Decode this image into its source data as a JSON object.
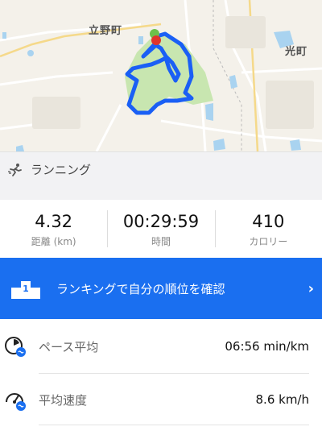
{
  "map": {
    "labels": [
      "立野町",
      "光町"
    ]
  },
  "activity": {
    "icon": "running-icon",
    "label": "ランニング"
  },
  "stats": [
    {
      "value": "4.32",
      "caption": "距離 (km)"
    },
    {
      "value": "00:29:59",
      "caption": "時間"
    },
    {
      "value": "410",
      "caption": "カロリー"
    }
  ],
  "ranking_banner": {
    "icon": "podium-icon",
    "text": "ランキングで自分の順位を確認",
    "chevron": "›",
    "color": "#1a6ff0"
  },
  "metrics": [
    {
      "icon": "pace-gauge-icon",
      "label": "ペース平均",
      "value": "06:56 min/km"
    },
    {
      "icon": "speed-gauge-icon",
      "label": "平均速度",
      "value": "8.6 km/h"
    }
  ],
  "colors": {
    "route": "#1a5ff5",
    "park": "#c8e6b0",
    "water": "#a9d3f0",
    "start_marker": "#6cc04a",
    "end_marker": "#e0342b"
  }
}
